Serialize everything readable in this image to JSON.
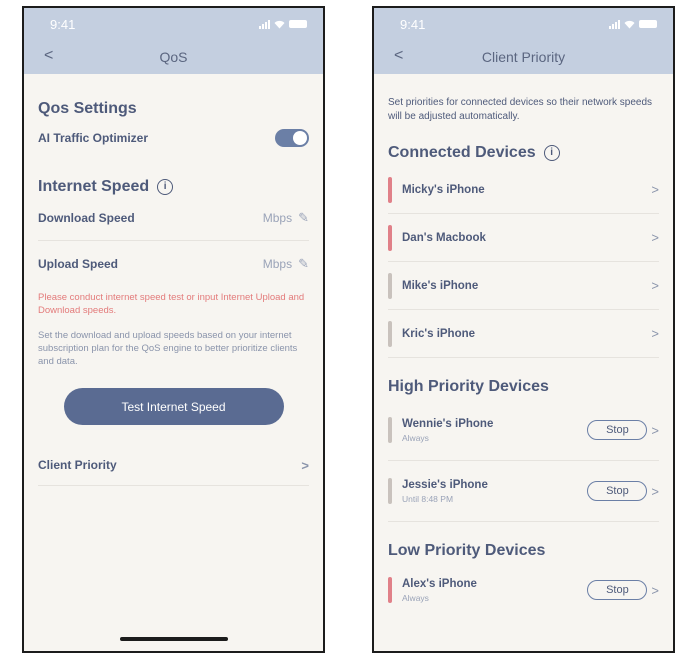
{
  "colors": {
    "header": "#c4cfe0",
    "accent": "#5a6b92",
    "warning": "#e37b7b",
    "priority_high": "#e08088",
    "priority_low": "#c9c2bd"
  },
  "left": {
    "status_time": "9:41",
    "nav_back": "<",
    "nav_title": "QoS",
    "settings_title": "Qos Settings",
    "ai_label": "AI Traffic Optimizer",
    "ai_toggle_on": true,
    "speed_title": "Internet Speed",
    "info_glyph": "i",
    "download_label": "Download Speed",
    "upload_label": "Upload Speed",
    "unit": "Mbps",
    "edit_glyph": "✎",
    "warning": "Please conduct internet speed test or input Internet Upload and Download speeds.",
    "help": "Set the download and upload speeds based on your internet subscription plan for the QoS engine to better prioritize clients and data.",
    "test_button": "Test Internet Speed",
    "client_priority": "Client Priority",
    "chevron": ">"
  },
  "right": {
    "status_time": "9:41",
    "nav_back": "<",
    "nav_title": "Client Priority",
    "intro": "Set priorities for connected devices so their network speeds will be adjusted automatically.",
    "connected_title": "Connected Devices",
    "info_glyph": "i",
    "chevron": ">",
    "connected": [
      {
        "name": "Micky's iPhone",
        "color": "#e08088"
      },
      {
        "name": "Dan's Macbook",
        "color": "#e08088"
      },
      {
        "name": "Mike's iPhone",
        "color": "#c9c2bd"
      },
      {
        "name": "Kric's iPhone",
        "color": "#c9c2bd"
      }
    ],
    "high_title": "High Priority Devices",
    "high": [
      {
        "name": "Wennie's iPhone",
        "sub": "Always",
        "color": "#c9c2bd"
      },
      {
        "name": "Jessie's iPhone",
        "sub": "Until 8:48 PM",
        "color": "#c9c2bd"
      }
    ],
    "low_title": "Low Priority Devices",
    "low": [
      {
        "name": "Alex's iPhone",
        "sub": "Always",
        "color": "#e08088"
      }
    ],
    "stop_label": "Stop"
  }
}
